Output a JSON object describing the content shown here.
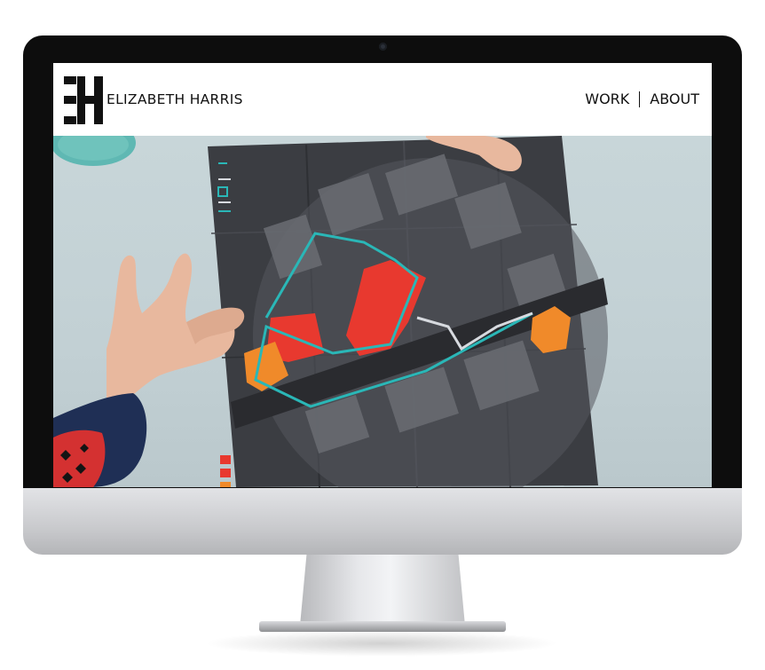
{
  "header": {
    "brand_name": "ELIZABETH HARRIS",
    "logo_icon": "eh-monogram-icon"
  },
  "nav": {
    "items": [
      {
        "label": "WORK"
      },
      {
        "label": "ABOUT"
      }
    ]
  },
  "hero": {
    "image": "hands-holding-folded-map-image",
    "slide_count": 4
  },
  "colors": {
    "map_background": "#3b3d42",
    "route_teal": "#2ab7b7",
    "area_red": "#e8392f",
    "area_orange": "#f08a2a",
    "sky": "#c7d3d7"
  }
}
